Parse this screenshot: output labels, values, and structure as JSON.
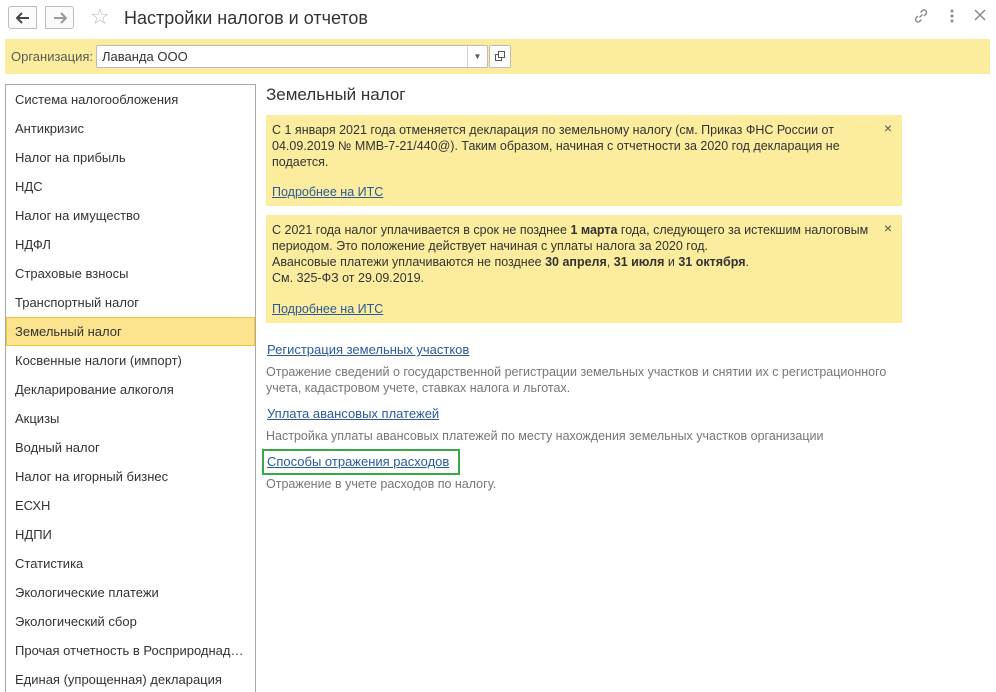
{
  "window": {
    "title": "Настройки налогов и отчетов",
    "back_icon": "arrow-left-icon",
    "forward_icon": "arrow-right-icon",
    "favorite_icon": "star-icon",
    "link_icon": "link-icon",
    "more_icon": "more-vertical-icon",
    "close_icon": "close-icon"
  },
  "org": {
    "label": "Организация:",
    "value": "Лаванда ООО"
  },
  "sidebar": {
    "items": [
      {
        "label": "Система налогообложения",
        "active": false
      },
      {
        "label": "Антикризис",
        "active": false
      },
      {
        "label": "Налог на прибыль",
        "active": false
      },
      {
        "label": "НДС",
        "active": false
      },
      {
        "label": "Налог на имущество",
        "active": false
      },
      {
        "label": "НДФЛ",
        "active": false
      },
      {
        "label": "Страховые взносы",
        "active": false
      },
      {
        "label": "Транспортный налог",
        "active": false
      },
      {
        "label": "Земельный налог",
        "active": true
      },
      {
        "label": "Косвенные налоги (импорт)",
        "active": false
      },
      {
        "label": "Декларирование алкоголя",
        "active": false
      },
      {
        "label": "Акцизы",
        "active": false
      },
      {
        "label": "Водный налог",
        "active": false
      },
      {
        "label": "Налог на игорный бизнес",
        "active": false
      },
      {
        "label": "ЕСХН",
        "active": false
      },
      {
        "label": "НДПИ",
        "active": false
      },
      {
        "label": "Статистика",
        "active": false
      },
      {
        "label": "Экологические платежи",
        "active": false
      },
      {
        "label": "Экологический сбор",
        "active": false
      },
      {
        "label": "Прочая отчетность в Росприроднад…",
        "active": false
      },
      {
        "label": "Единая (упрощенная) декларация",
        "active": false
      }
    ]
  },
  "main": {
    "title": "Земельный налог",
    "notice1": {
      "text": "С 1 января 2021 года отменяется декларация по земельному налогу (см. Приказ ФНС России от 04.09.2019 № ММВ-7-21/440@). Таким образом, начиная с отчетности за 2020 год декларация не подается.",
      "link": "Подробнее на ИТС",
      "close": "×"
    },
    "notice2": {
      "p1_a": "С 2021 года налог уплачивается в срок не позднее ",
      "p1_b": "1 марта",
      "p1_c": " года, следующего за истекшим налоговым периодом. Это положение действует начиная с уплаты налога за 2020 год.",
      "p2_a": "Авансовые платежи уплачиваются не позднее ",
      "p2_b": "30 апреля",
      "p2_c": ", ",
      "p2_d": "31 июля",
      "p2_e": " и ",
      "p2_f": "31 октября",
      "p2_g": ".",
      "p3": "См. 325-ФЗ от 29.09.2019.",
      "link": "Подробнее на ИТС",
      "close": "×"
    },
    "links": [
      {
        "label": "Регистрация земельных участков",
        "desc": "Отражение сведений о государственной регистрации земельных участков и снятии их с регистрационного учета, кадастровом учете, ставках налога и льготах."
      },
      {
        "label": "Уплата авансовых платежей",
        "desc": "Настройка уплаты авансовых платежей по месту нахождения земельных участков организации"
      },
      {
        "label": "Способы отражения расходов",
        "desc": "Отражение в учете расходов по налогу."
      }
    ]
  }
}
